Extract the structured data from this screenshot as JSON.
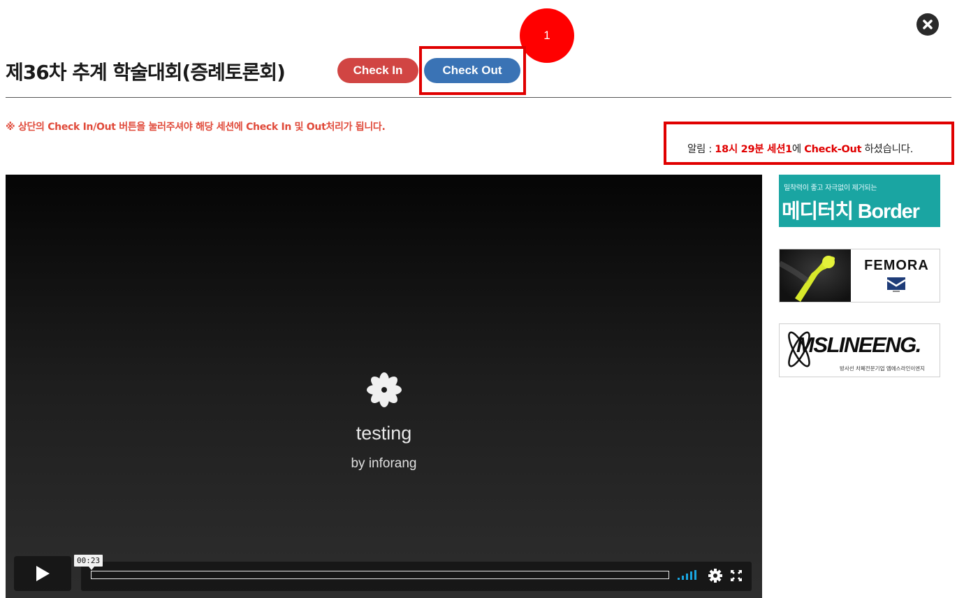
{
  "header": {
    "title": "제36차 추계 학술대회(증례토론회)",
    "check_in_label": "Check In",
    "check_out_label": "Check Out",
    "step_marker": "1",
    "close_icon": "close-icon"
  },
  "instruction": "※ 상단의 Check In/Out 버튼을 눌러주셔야 해당 세션에 Check In 및 Out처리가 됩니다.",
  "notice": {
    "prefix": "알림 : ",
    "time_session": "18시 29분 세션1",
    "mid": "에 ",
    "action": "Check-Out",
    "suffix": " 하셨습니다."
  },
  "video": {
    "title": "testing",
    "subtitle": "by inforang",
    "current_time": "00:23"
  },
  "ads": [
    {
      "subtitle": "밀착력이 좋고 자극없이 제거되는",
      "title": "메디터치 Border"
    },
    {
      "title": "FEMORA"
    },
    {
      "title": "MSLINEENG.",
      "subtitle": "방사선 차폐전문기업 엠에스라인이엔지"
    }
  ],
  "colors": {
    "check_in": "#d14543",
    "check_out": "#3a73b5",
    "highlight": "#e00000",
    "instruction": "#e04a3a",
    "ad_teal": "#1aa5a2"
  }
}
